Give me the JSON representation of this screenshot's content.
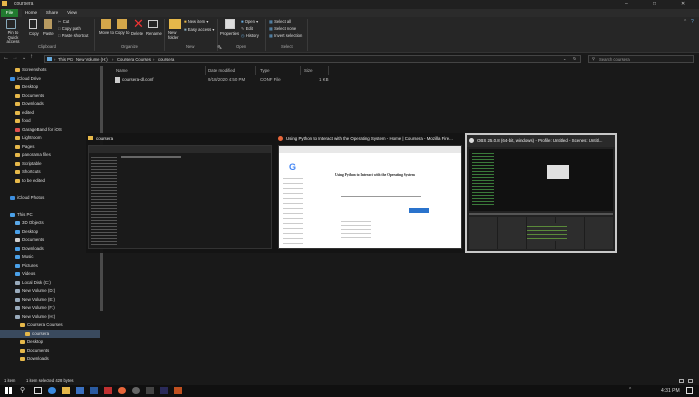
{
  "window": {
    "title": "coursera"
  },
  "ribbon_tabs": [
    "File",
    "Home",
    "Share",
    "View"
  ],
  "ribbon": {
    "clipboard": {
      "pin": "Pin to Quick access",
      "copy": "Copy",
      "paste": "Paste",
      "cut": "Cut",
      "copy_path": "Copy path",
      "paste_shortcut": "Paste shortcut",
      "group": "Clipboard"
    },
    "organize": {
      "move_to": "Move to",
      "copy_to": "Copy to",
      "delete": "Delete",
      "rename": "Rename",
      "group": "Organize"
    },
    "new": {
      "new_folder": "New folder",
      "new_item": "New item",
      "easy_access": "Easy access",
      "group": "New"
    },
    "open": {
      "properties": "Properties",
      "open": "Open",
      "edit": "Edit",
      "history": "History",
      "group": "Open"
    },
    "select": {
      "select_all": "Select all",
      "select_none": "Select none",
      "invert": "Invert selection",
      "group": "Select"
    }
  },
  "breadcrumb": [
    "This PC",
    "New Volume (H:)",
    "Coursera Courses",
    "coursera"
  ],
  "search": {
    "placeholder": "Search coursera"
  },
  "sidebar": {
    "items": [
      {
        "label": "Screenshots",
        "indent": 1,
        "color": "#e6b84a"
      },
      {
        "label": "iCloud Drive",
        "indent": 0,
        "color": "#3d8fe0"
      },
      {
        "label": "Desktop",
        "indent": 1,
        "color": "#e6b84a"
      },
      {
        "label": "Documents",
        "indent": 1,
        "color": "#e6b84a"
      },
      {
        "label": "Downloads",
        "indent": 1,
        "color": "#e6b84a"
      },
      {
        "label": "edited",
        "indent": 1,
        "color": "#e6b84a"
      },
      {
        "label": "food",
        "indent": 1,
        "color": "#e6b84a"
      },
      {
        "label": "GarageBand for iOS",
        "indent": 1,
        "color": "#e05050"
      },
      {
        "label": "Lightroom",
        "indent": 1,
        "color": "#e6b84a"
      },
      {
        "label": "Pages",
        "indent": 1,
        "color": "#e6b84a"
      },
      {
        "label": "panorama files",
        "indent": 1,
        "color": "#e6b84a"
      },
      {
        "label": "Scriptable",
        "indent": 1,
        "color": "#e6b84a"
      },
      {
        "label": "Shortcuts",
        "indent": 1,
        "color": "#e6b84a"
      },
      {
        "label": "to be edited",
        "indent": 1,
        "color": "#e6b84a"
      },
      {
        "label": "",
        "indent": 0,
        "color": ""
      },
      {
        "label": "iCloud Photos",
        "indent": 0,
        "color": "#3d8fe0"
      },
      {
        "label": "",
        "indent": 0,
        "color": ""
      },
      {
        "label": "This PC",
        "indent": 0,
        "color": "#4aa0e8"
      },
      {
        "label": "3D Objects",
        "indent": 1,
        "color": "#5aa8e8"
      },
      {
        "label": "Desktop",
        "indent": 1,
        "color": "#4aa0e8"
      },
      {
        "label": "Documents",
        "indent": 1,
        "color": "#cfcfcf"
      },
      {
        "label": "Downloads",
        "indent": 1,
        "color": "#4aa0e8"
      },
      {
        "label": "Music",
        "indent": 1,
        "color": "#4aa0e8"
      },
      {
        "label": "Pictures",
        "indent": 1,
        "color": "#4aa0e8"
      },
      {
        "label": "Videos",
        "indent": 1,
        "color": "#4aa0e8"
      },
      {
        "label": "Local Disk (C:)",
        "indent": 1,
        "color": "#9ab"
      },
      {
        "label": "New Volume (D:)",
        "indent": 1,
        "color": "#9ab"
      },
      {
        "label": "New Volume (E:)",
        "indent": 1,
        "color": "#9ab"
      },
      {
        "label": "New Volume (F:)",
        "indent": 1,
        "color": "#9ab"
      },
      {
        "label": "New Volume (H:)",
        "indent": 1,
        "color": "#9ab"
      },
      {
        "label": "Coursera Courses",
        "indent": 2,
        "color": "#e6b84a"
      },
      {
        "label": "coursera",
        "indent": 3,
        "color": "#e6b84a"
      },
      {
        "label": "Desktop",
        "indent": 2,
        "color": "#e6b84a"
      },
      {
        "label": "Documents",
        "indent": 2,
        "color": "#e6b84a"
      },
      {
        "label": "Downloads",
        "indent": 2,
        "color": "#e6b84a"
      }
    ]
  },
  "columns": [
    "Name",
    "Date modified",
    "Type",
    "Size"
  ],
  "files": [
    {
      "name": "coursera-dl.conf",
      "date": "9/18/2020 4:50 PM",
      "type": "CONF File",
      "size": "1 KB"
    }
  ],
  "status": {
    "items": "1 item",
    "selected": "1 item selected  428 bytes"
  },
  "task_switcher": [
    {
      "title": "coursera"
    },
    {
      "title": "Using Python to Interact with the Operating System - Home | Coursera - Mozilla Fire..."
    },
    {
      "title": "OBS 25.0.8 (64-bit, windows) - Profile: Untitled - Scenes: Untitl..."
    }
  ],
  "browser_thumb": {
    "heading": "Using Python to Interact with the Operating System"
  },
  "clock": {
    "time": "4:31 PM"
  },
  "colors": {
    "accent": "#217a2f",
    "folder": "#e6b84a",
    "selection": "#3a4a5e"
  }
}
